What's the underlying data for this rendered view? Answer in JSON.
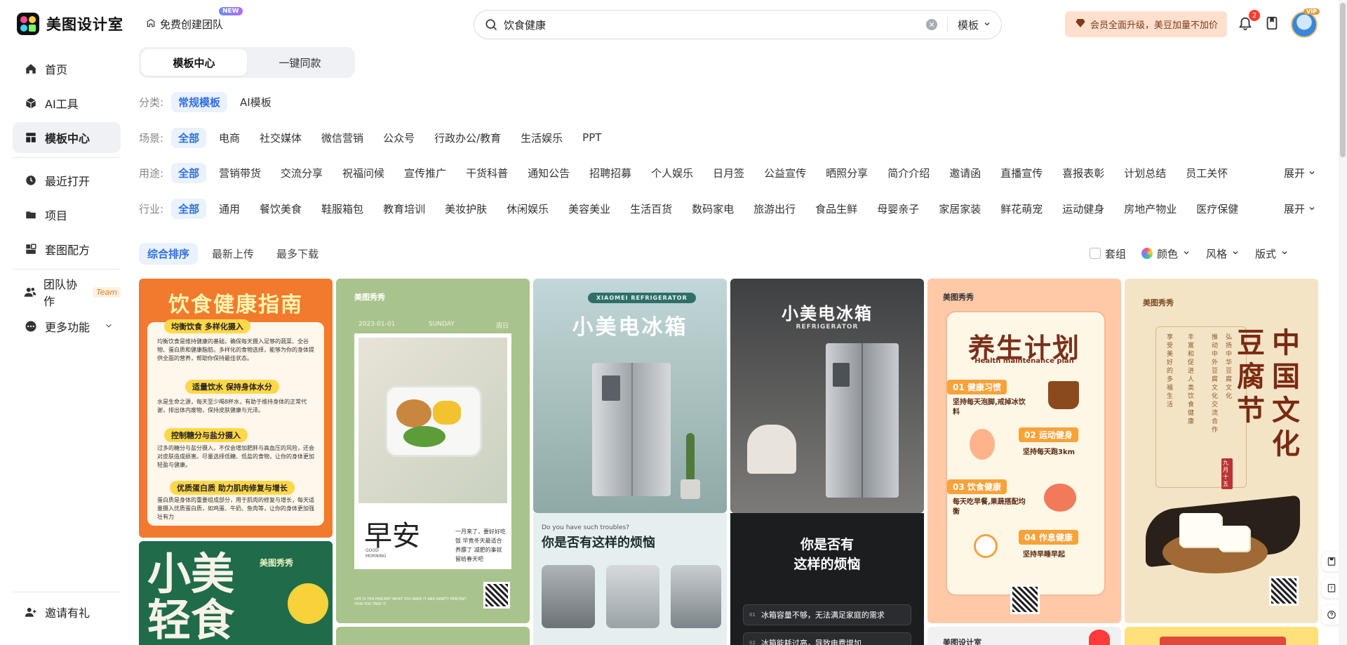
{
  "app": {
    "name": "美图设计室"
  },
  "header": {
    "team_create": "免费创建团队",
    "new_badge": "NEW",
    "search_value": "饮食健康",
    "search_type": "模板",
    "vip_banner": "会员全面升级，美豆加量不加价",
    "notif_count": "2",
    "vip_mini": "VIP"
  },
  "sidebar": {
    "items": [
      {
        "label": "首页",
        "icon": "home-icon"
      },
      {
        "label": "AI工具",
        "icon": "cube-icon"
      },
      {
        "label": "模板中心",
        "icon": "grid-icon"
      },
      {
        "label": "最近打开",
        "icon": "clock-icon"
      },
      {
        "label": "项目",
        "icon": "folder-icon"
      },
      {
        "label": "套图配方",
        "icon": "layers-icon"
      },
      {
        "label": "团队协作",
        "icon": "team-icon",
        "badge": "Team"
      },
      {
        "label": "更多功能",
        "icon": "more-icon"
      }
    ],
    "invite": "邀请有礼"
  },
  "tabs": [
    {
      "label": "模板中心"
    },
    {
      "label": "一键同款"
    }
  ],
  "filters": {
    "category": {
      "label": "分类:",
      "items": [
        "常规模板",
        "AI模板"
      ]
    },
    "scene": {
      "label": "场景:",
      "items": [
        "全部",
        "电商",
        "社交媒体",
        "微信营销",
        "公众号",
        "行政办公/教育",
        "生活娱乐",
        "PPT"
      ]
    },
    "usage": {
      "label": "用途:",
      "items": [
        "全部",
        "营销带货",
        "交流分享",
        "祝福问候",
        "宣传推广",
        "干货科普",
        "通知公告",
        "招聘招募",
        "个人娱乐",
        "日月签",
        "公益宣传",
        "晒照分享",
        "简介介绍",
        "邀请函",
        "直播宣传",
        "喜报表彰",
        "计划总结",
        "员工关怀"
      ]
    },
    "industry": {
      "label": "行业:",
      "items": [
        "全部",
        "通用",
        "餐饮美食",
        "鞋服箱包",
        "教育培训",
        "美妆护肤",
        "休闲娱乐",
        "美容美业",
        "生活百货",
        "数码家电",
        "旅游出行",
        "食品生鲜",
        "母婴亲子",
        "家居家装",
        "鲜花萌宠",
        "运动健身",
        "房地产物业",
        "医疗保健"
      ]
    },
    "expand": "展开"
  },
  "sort": {
    "items": [
      "综合排序",
      "最新上传",
      "最多下载"
    ]
  },
  "view_tools": {
    "group": "套组",
    "color": "颜色",
    "style": "风格",
    "format": "版式"
  },
  "cards": {
    "c1": {
      "title": "饮食健康指南",
      "s1": "均衡饮食 多样化摄入",
      "p1": "均衡饮食是维持健康的基础，确保每天摄入足够的蔬菜、全谷物、蛋白质和健康脂肪。多样化的食物选择，能够为你的身体提供全面的营养，帮助你保持最佳状态。",
      "s2": "适量饮水 保持身体水分",
      "p2": "水是生命之源，每天至少喝8杯水，有助于维持身体的正常代谢，排出体内废物，保持皮肤健康与光泽。",
      "s3": "控制糖分与盐分摄入",
      "p3": "过多的糖分与盐分摄入，不仅会增加肥胖与高血压的风险，还会对皮肤造成损害。尽量选择低糖、低盐的食物，让你的身体更加轻盈与健康。",
      "s4": "优质蛋白质 助力肌肉修复与增长",
      "p4": "蛋白质是身体的重要组成部分，用于肌肉的修复与增长，每天适量摄入优质蛋白质，如鸡蛋、牛奶、鱼肉等，让你的身体更加强壮有力"
    },
    "c1b": {
      "big1": "小美",
      "big2": "轻食",
      "brand": "美图秀秀"
    },
    "c2": {
      "brand": "美图秀秀",
      "date": "2023-01-01",
      "day": "SUNDAY",
      "zh_day": "周日",
      "big": "早安",
      "sub": "GOOD MORNING",
      "text": "一月来了，要好好吃饭 毕竟冬天最适合养膘了 减肥的事就留给春天吧",
      "foot": "LIFE IS TEN PERCENT WHAT YOU MAKE IT AND NINETY PERCENT HOW YOU TAKE IT."
    },
    "c3": {
      "tag": "XIAOMEI REFRIGERATOR",
      "title": "小美电冰箱",
      "q_en": "Do you have such troubles?",
      "q": "你是否有这样的烦恼"
    },
    "c4": {
      "title": "小美电冰箱",
      "en": "REFRIGERATOR",
      "q1": "你是否有",
      "q2": "这样的烦恼",
      "l1": "冰箱容量不够，无法满足家庭的需求",
      "n1": "01",
      "l2": "冰箱能耗过高，导致电费增加",
      "n2": "02"
    },
    "c5": {
      "brand": "美图秀秀",
      "title": "养生计划",
      "en": "Health maintenance plan",
      "i1": "01 健康习惯",
      "d1": "坚持每天泡脚,戒掉冰饮料",
      "i2": "02 运动健身",
      "d2": "坚持每天跑3km",
      "i3": "03 饮食健康",
      "d3": "每天吃早餐,果蔬搭配均衡",
      "i4": "04 作息健康",
      "d4": "坚持早睡早起",
      "foot_brand": "美图设计室"
    },
    "c6": {
      "brand": "美图秀秀",
      "title": "中国文化",
      "title2": "豆腐节",
      "v1": "弘扬中华豆腐文化",
      "v2": "推动中外豆腐文化交流合作",
      "v3": "丰富和促进人类饮食健康",
      "v4": "享受美好的多福生活",
      "seal": "九月十五"
    }
  },
  "colors": {
    "accent": "#2f6fe4",
    "accent_bg": "#eaf2ff",
    "vip_bg": "#ffe0cf"
  }
}
